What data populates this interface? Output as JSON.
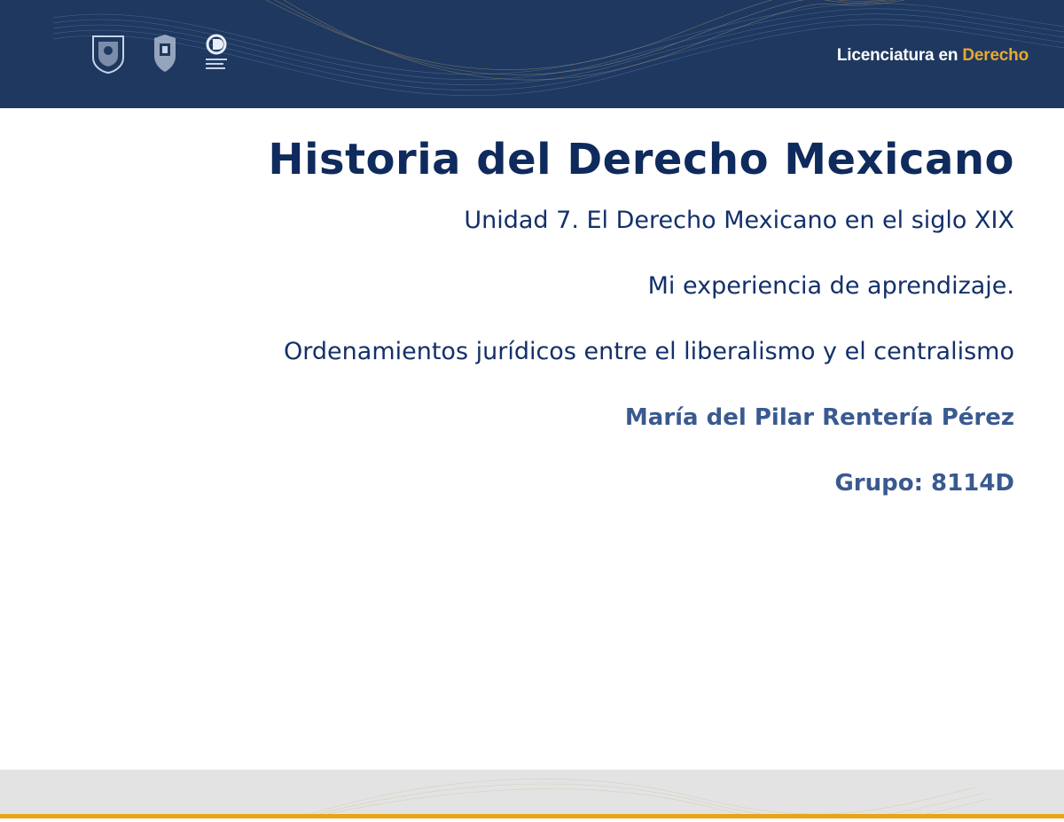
{
  "header": {
    "program_prefix": "Licenciatura en ",
    "program_accent": "Derecho",
    "logos": [
      "unam-seal-icon",
      "faculty-shield-icon",
      "cuaed-logo-icon"
    ]
  },
  "slide": {
    "title": "Historia del Derecho Mexicano",
    "unit": "Unidad 7. El Derecho Mexicano en el siglo XIX",
    "activity": "Mi experiencia de aprendizaje.",
    "topic": "Ordenamientos jurídicos entre el liberalismo y el centralismo",
    "author": "María del Pilar Rentería Pérez",
    "group": "Grupo: 8114D"
  },
  "colors": {
    "header_bg": "#1e3860",
    "accent": "#e8a830",
    "title": "#0f2a5c",
    "author": "#3a5a8f",
    "footer_line": "#e8a414"
  }
}
